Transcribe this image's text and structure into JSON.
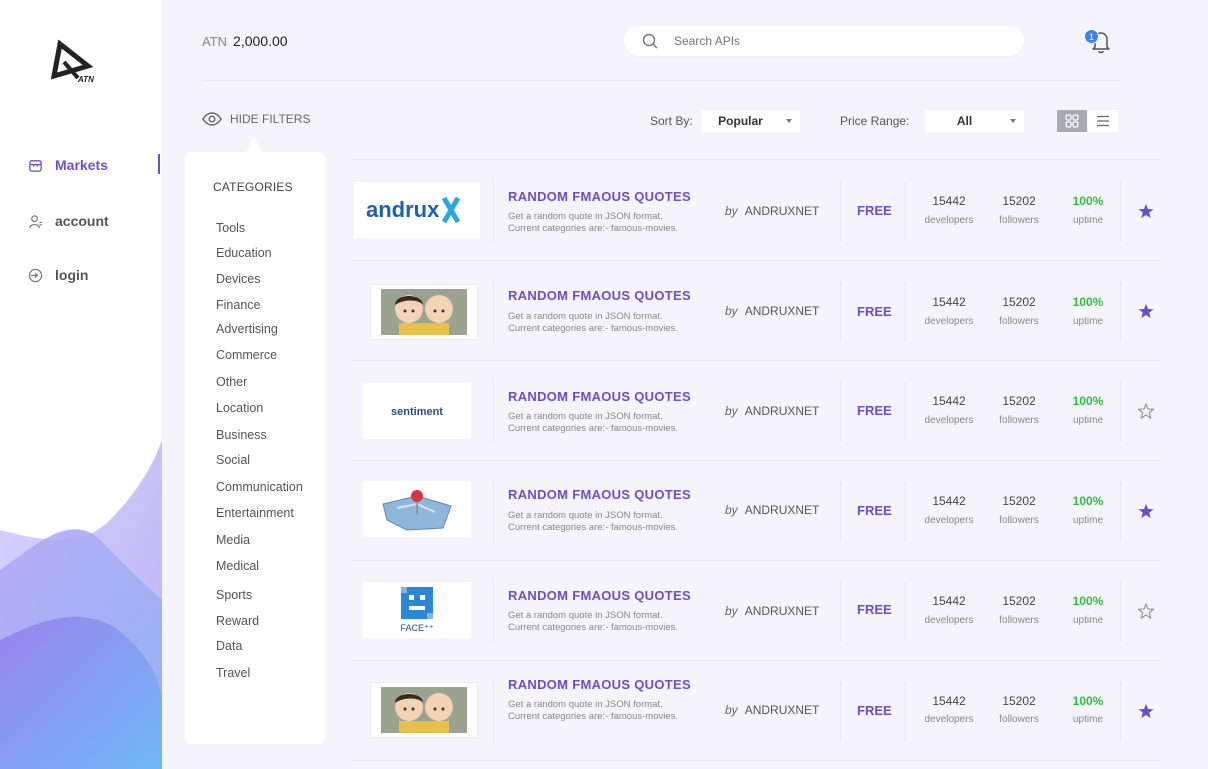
{
  "header": {
    "currency": "ATN",
    "balance": "2,000.00",
    "search_placeholder": "Search APIs",
    "notification_count": "1"
  },
  "sidebar": {
    "logo_text": "ATN",
    "items": [
      {
        "label": "Markets",
        "icon": "store-icon",
        "active": true
      },
      {
        "label": "account",
        "icon": "user-icon",
        "active": false
      },
      {
        "label": "login",
        "icon": "login-icon",
        "active": false
      }
    ]
  },
  "filters": {
    "hide_label": "HIDE FILTERS",
    "sort_label": "Sort By:",
    "sort_value": "Popular",
    "price_label": "Price Range:",
    "price_value": "All"
  },
  "categories": {
    "title": "CATEGORIES",
    "items": [
      "Tools",
      "Education",
      "Devices",
      "Finance",
      "Advertising",
      "Commerce",
      "Other",
      "Location",
      "Business",
      "Social",
      "Communication",
      "Entertainment",
      "Media",
      "Medical",
      "Sports",
      "Reward",
      "Data",
      "Travel"
    ]
  },
  "apis": [
    {
      "thumb": "andrux-logo",
      "thumb_text": "andrux",
      "title": "RANDOM FMAOUS QUOTES",
      "desc1": "Get a random quote in JSON format.",
      "desc2": "Current categories are:- famous-movies.",
      "by_prefix": "by",
      "author": "ANDRUXNET",
      "price": "FREE",
      "developers": "15442",
      "developers_label": "developers",
      "followers": "15202",
      "followers_label": "followers",
      "uptime": "100%",
      "uptime_label": "uptime",
      "starred": true
    },
    {
      "thumb": "cartoon-couple-image",
      "title": "RANDOM FMAOUS QUOTES",
      "desc1": "Get a random quote in JSON format.",
      "desc2": "Current categories are:- famous-movies.",
      "by_prefix": "by",
      "author": "ANDRUXNET",
      "price": "FREE",
      "developers": "15442",
      "developers_label": "developers",
      "followers": "15202",
      "followers_label": "followers",
      "uptime": "100%",
      "uptime_label": "uptime",
      "starred": true
    },
    {
      "thumb": "sentiment-logo",
      "thumb_text": "sentiment",
      "title": "RANDOM FMAOUS QUOTES",
      "desc1": "Get a random quote in JSON format.",
      "desc2": "Current categories are:- famous-movies.",
      "by_prefix": "by",
      "author": "ANDRUXNET",
      "price": "FREE",
      "developers": "15442",
      "developers_label": "developers",
      "followers": "15202",
      "followers_label": "followers",
      "uptime": "100%",
      "uptime_label": "uptime",
      "starred": false
    },
    {
      "thumb": "map-pin-image",
      "title": "RANDOM FMAOUS QUOTES",
      "desc1": "Get a random quote in JSON format.",
      "desc2": "Current categories are:- famous-movies.",
      "by_prefix": "by",
      "author": "ANDRUXNET",
      "price": "FREE",
      "developers": "15442",
      "developers_label": "developers",
      "followers": "15202",
      "followers_label": "followers",
      "uptime": "100%",
      "uptime_label": "uptime",
      "starred": true
    },
    {
      "thumb": "faceplusplus-logo",
      "thumb_text": "FACE⁺⁺",
      "title": "RANDOM FMAOUS QUOTES",
      "desc1": "Get a random quote in JSON format.",
      "desc2": "Current categories are:- famous-movies.",
      "by_prefix": "by",
      "author": "ANDRUXNET",
      "price": "FREE",
      "developers": "15442",
      "developers_label": "developers",
      "followers": "15202",
      "followers_label": "followers",
      "uptime": "100%",
      "uptime_label": "uptime",
      "starred": false
    },
    {
      "thumb": "cartoon-couple-image",
      "title": "RANDOM FMAOUS QUOTES",
      "desc1": "Get a random quote in JSON format.",
      "desc2": "Current categories are:- famous-movies.",
      "by_prefix": "by",
      "author": "ANDRUXNET",
      "price": "FREE",
      "developers": "15442",
      "developers_label": "developers",
      "followers": "15202",
      "followers_label": "followers",
      "uptime": "100%",
      "uptime_label": "uptime",
      "starred": true
    }
  ],
  "colors": {
    "accent": "#6a4fcf",
    "uptime_green": "#2fbf3c",
    "badge_blue": "#3b7ff0",
    "background": "#f5f4fb"
  }
}
